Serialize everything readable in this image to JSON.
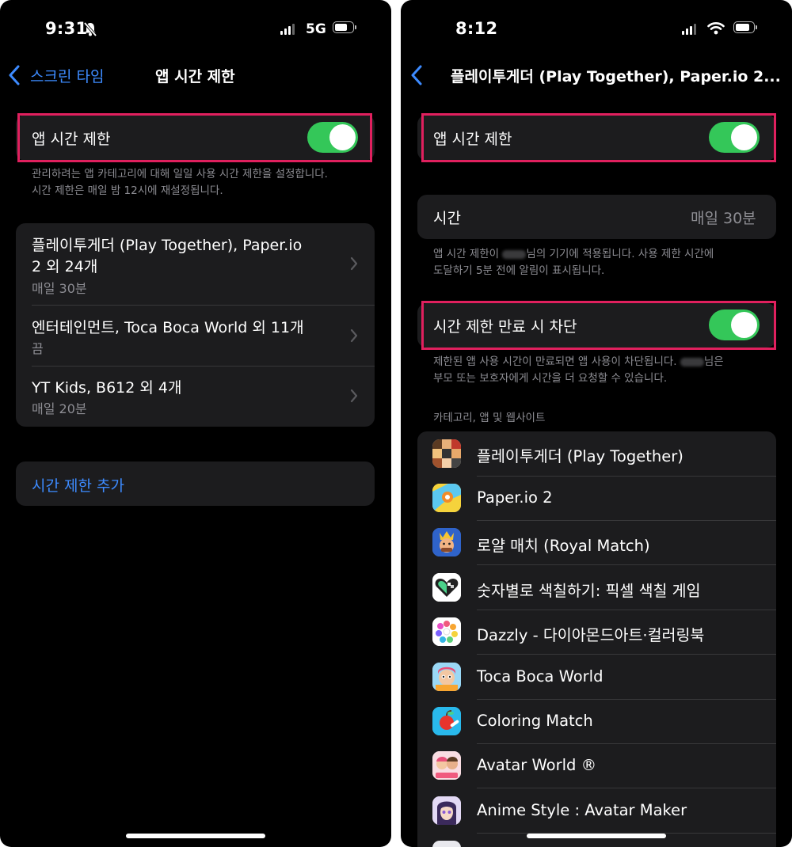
{
  "left": {
    "status": {
      "time": "9:31",
      "network": "5G"
    },
    "nav": {
      "back_label": "스크린 타임",
      "title": "앱 시간 제한"
    },
    "toggle_row": {
      "label": "앱 시간 제한",
      "on": true
    },
    "toggle_footnote": "관리하려는 앱 카테고리에 대해 일일 사용 시간 제한을 설정합니다. 시간 제한은 매일 밤 12시에 재설정됩니다.",
    "limits": [
      {
        "title_line1": "플레이투게더 (Play Together), Paper.io",
        "title_line2": "2 외 24개",
        "subtitle": "매일 30분"
      },
      {
        "title_line1": "엔터테인먼트, Toca Boca World 외 11개",
        "subtitle": "끔"
      },
      {
        "title_line1": "YT Kids, B612 외 4개",
        "subtitle": "매일 20분"
      }
    ],
    "add_limit_label": "시간 제한 추가"
  },
  "right": {
    "status": {
      "time": "8:12"
    },
    "nav": {
      "title": "플레이투게더 (Play Together), Paper.io 2..."
    },
    "toggle_row": {
      "label": "앱 시간 제한",
      "on": true
    },
    "time_row": {
      "label": "시간",
      "value": "매일 30분"
    },
    "time_footnote_a": "앱 시간 제한이",
    "time_footnote_b": "님의 기기에 적용됩니다. 사용 제한 시간에",
    "time_footnote_c": "도달하기 5분 전에 알림이 표시됩니다.",
    "block_row": {
      "label": "시간 제한 만료 시 차단",
      "on": true
    },
    "block_footnote_a": "제한된 앱 사용 시간이 만료되면 앱 사용이 차단됩니다.",
    "block_footnote_b": "님은",
    "block_footnote_c": "부모 또는 보호자에게 시간을 더 요청할 수 있습니다.",
    "section_header": "카테고리, 앱 및 웹사이트",
    "apps": [
      {
        "name": "플레이투게더 (Play Together)",
        "icon": "play-together-icon"
      },
      {
        "name": "Paper.io 2",
        "icon": "paperio-icon"
      },
      {
        "name": "로얄 매치 (Royal Match)",
        "icon": "royal-match-icon"
      },
      {
        "name": "숫자별로 색칠하기: 픽셀 색칠 게임",
        "icon": "pixel-heart-icon"
      },
      {
        "name": "Dazzly - 다이아몬드아트·컬러링북",
        "icon": "dazzly-icon"
      },
      {
        "name": "Toca Boca World",
        "icon": "toca-boca-icon"
      },
      {
        "name": "Coloring Match",
        "icon": "coloring-match-icon"
      },
      {
        "name": "Avatar World ®",
        "icon": "avatar-world-icon"
      },
      {
        "name": "Anime Style : Avatar Maker",
        "icon": "anime-style-icon"
      }
    ]
  },
  "colors": {
    "accent": "#3d8bff",
    "toggle_on": "#34c759",
    "highlight": "#e0205e",
    "cell_bg": "#1c1c1e"
  }
}
